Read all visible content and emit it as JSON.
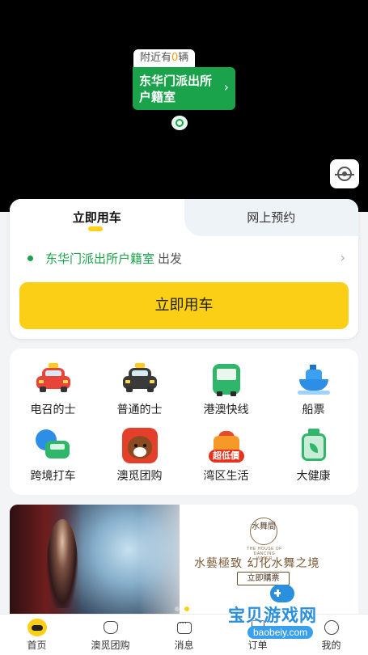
{
  "map": {
    "nearby_prefix": "附近有",
    "nearby_count": "0",
    "nearby_suffix": "辆",
    "pickup_card": "东华门派出所户籍室",
    "pickup_chevron": "›",
    "locate_icon": "crosshair-icon"
  },
  "booking": {
    "tabs": [
      {
        "label": "立即用车",
        "active": true
      },
      {
        "label": "网上预约",
        "active": false
      }
    ],
    "pickup_location": "东华门派出所户籍室",
    "depart_label": "出发",
    "row_chevron": "›",
    "cta_label": "立即用车"
  },
  "services": [
    {
      "label": "电召的士",
      "icon": "red-taxi-icon"
    },
    {
      "label": "普通的士",
      "icon": "black-taxi-icon"
    },
    {
      "label": "港澳快线",
      "icon": "bus-icon"
    },
    {
      "label": "船票",
      "icon": "ship-icon"
    },
    {
      "label": "跨境打车",
      "icon": "cross-border-icon"
    },
    {
      "label": "澳觅团购",
      "icon": "bear-icon"
    },
    {
      "label": "湾区生活",
      "icon": "shopping-bag-icon",
      "badge": "超低價"
    },
    {
      "label": "大健康",
      "icon": "health-bottle-icon"
    }
  ],
  "banner": {
    "logo_text": "水舞間",
    "logo_sub": "THE HOUSE OF DANCING WATER",
    "slogan": "水藝極致 幻化水舞之境",
    "button": "立即購票",
    "slides_total": 2,
    "active_slide": 2
  },
  "watermark": {
    "title": "宝贝游戏网",
    "subtitle": "baobeiy.com"
  },
  "nav": [
    {
      "label": "首页",
      "icon": "home-icon",
      "active": true
    },
    {
      "label": "澳觅团购",
      "icon": "cat-icon",
      "active": false
    },
    {
      "label": "消息",
      "icon": "message-icon",
      "active": false
    },
    {
      "label": "订单",
      "icon": "order-icon",
      "active": false
    },
    {
      "label": "我的",
      "icon": "profile-icon",
      "active": false
    }
  ],
  "colors": {
    "brand_yellow": "#fccf17",
    "brand_green": "#1aa34a",
    "map_bg": "#000000"
  }
}
